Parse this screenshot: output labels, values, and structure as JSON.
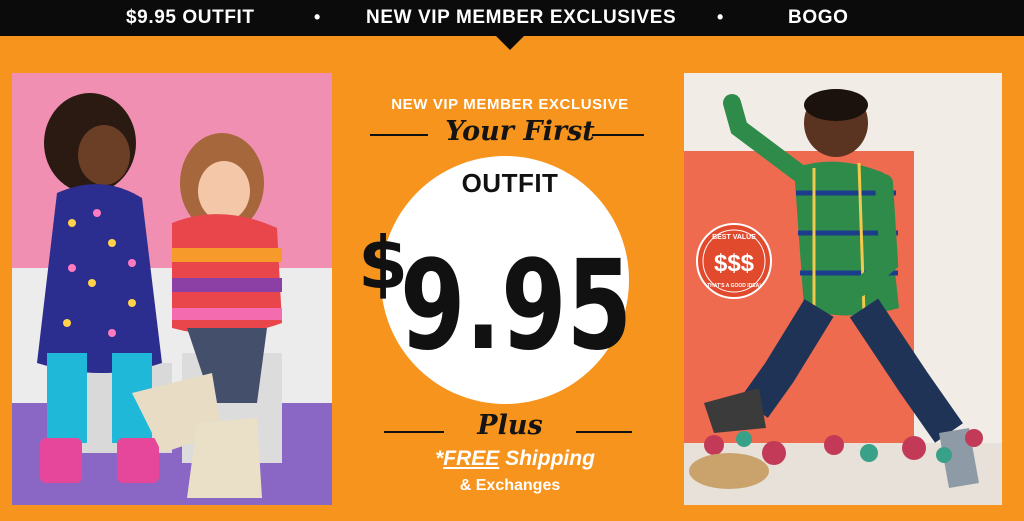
{
  "nav": {
    "items": [
      {
        "label": "$9.95 OUTFIT"
      },
      {
        "label": "NEW VIP MEMBER EXCLUSIVES"
      },
      {
        "label": "BOGO"
      }
    ],
    "separator": "•"
  },
  "promo": {
    "kicker": "NEW VIP MEMBER EXCLUSIVE",
    "headline": "Your First",
    "outfit_label": "OUTFIT",
    "price_symbol": "$",
    "price_value": "9.95",
    "plus": "Plus",
    "shipping_prefix": "*",
    "shipping_free": "FREE",
    "shipping_rest": " Shipping",
    "exchanges": "& Exchanges"
  },
  "badge": {
    "top_text": "BEST VALUE",
    "symbol_text": "$$$",
    "bottom_text": "THAT'S A GOOD IDEA!"
  },
  "colors": {
    "background": "#f7941d",
    "nav_bg": "#0b0b0b",
    "text_dark": "#111111",
    "badge_red": "#e24a2e"
  }
}
